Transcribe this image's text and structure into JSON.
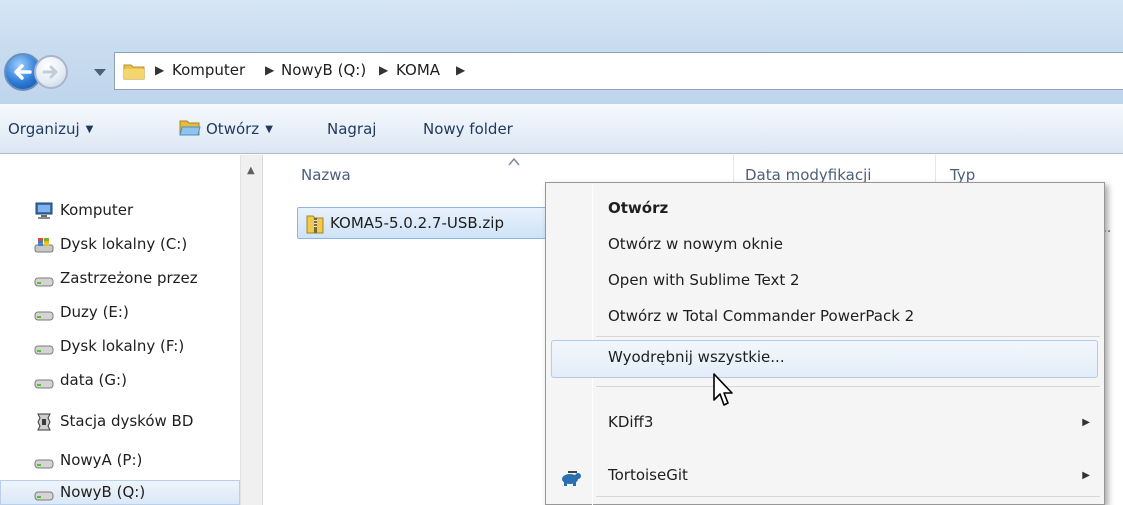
{
  "address_bar": {
    "breadcrumbs": [
      "Komputer",
      "NowyB (Q:)",
      "KOMA"
    ]
  },
  "toolbar": {
    "organize_label": "Organizuj",
    "open_label": "Otwórz",
    "burn_label": "Nagraj",
    "new_folder_label": "Nowy folder"
  },
  "nav_pane": {
    "items": [
      {
        "label": "Komputer",
        "icon": "computer-icon"
      },
      {
        "label": "Dysk lokalny (C:)",
        "icon": "system-drive-icon"
      },
      {
        "label": "Zastrzeżone przez",
        "icon": "drive-icon"
      },
      {
        "label": "Duzy (E:)",
        "icon": "drive-icon"
      },
      {
        "label": "Dysk lokalny (F:)",
        "icon": "drive-icon"
      },
      {
        "label": "data (G:)",
        "icon": "drive-icon"
      },
      {
        "label": "Stacja dysków BD",
        "icon": "bd-drive-icon"
      },
      {
        "label": "NowyA (P:)",
        "icon": "drive-icon"
      },
      {
        "label": "NowyB (Q:)",
        "icon": "drive-icon"
      }
    ]
  },
  "file_list": {
    "columns": [
      "Nazwa",
      "Data modyfikacji",
      "Typ"
    ],
    "files": [
      {
        "name": "KOMA5-5.0.2.7-USB.zip",
        "icon": "zip-folder-icon",
        "trailing_text": "..."
      }
    ]
  },
  "context_menu": {
    "items": [
      {
        "label": "Otwórz",
        "bold": true
      },
      {
        "label": "Otwórz w nowym oknie"
      },
      {
        "label": "Open with Sublime Text 2"
      },
      {
        "label": "Otwórz w Total Commander PowerPack 2"
      },
      {
        "label": "Wyodrębnij wszystkie...",
        "hovered": true
      },
      {
        "label": "KDiff3",
        "submenu": true
      },
      {
        "label": "TortoiseGit",
        "submenu": true,
        "icon": "tortoisegit-icon"
      }
    ]
  },
  "colors": {
    "address_bar_bg": "#c9dcef",
    "toolbar_bg": "#e9f0f8",
    "selection_bg": "#cfe3f8",
    "menu_bg": "#f5f5f5"
  }
}
